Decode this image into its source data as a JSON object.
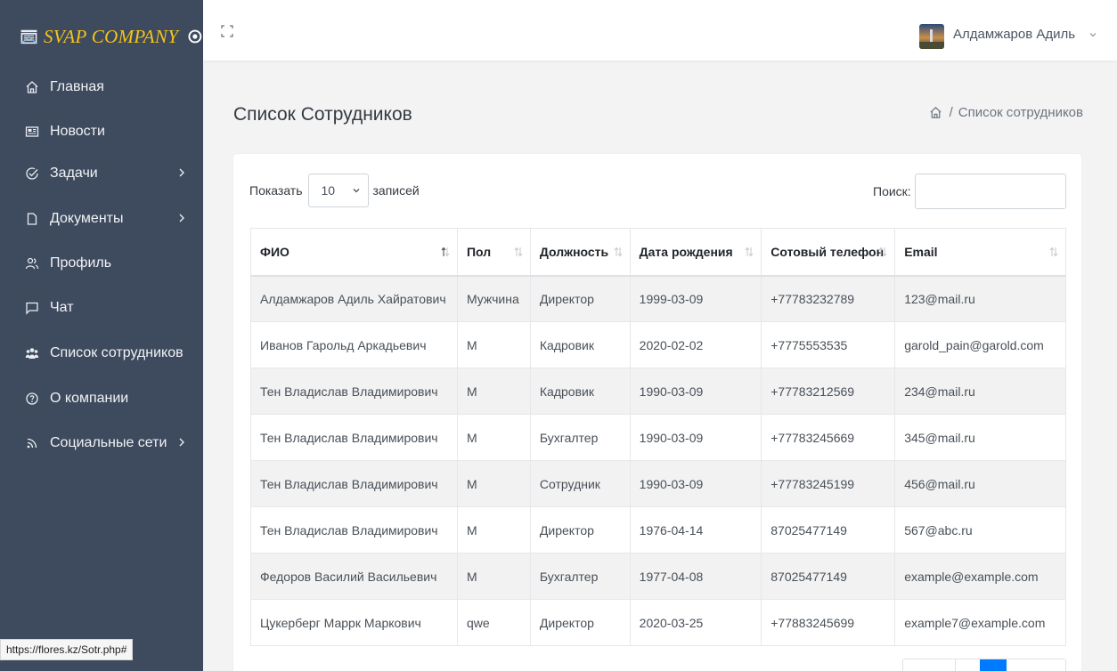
{
  "brand": {
    "name": "SVAP COMPANY"
  },
  "sidebar": {
    "items": [
      {
        "label": "Главная",
        "icon": "home-icon"
      },
      {
        "label": "Новости",
        "icon": "newspaper-icon"
      },
      {
        "label": "Задачи",
        "icon": "check-circle-icon",
        "has_submenu": true
      },
      {
        "label": "Документы",
        "icon": "document-icon",
        "has_submenu": true
      },
      {
        "label": "Профиль",
        "icon": "users-icon"
      },
      {
        "label": "Чат",
        "icon": "chat-icon"
      },
      {
        "label": "Список сотрудников",
        "icon": "team-icon"
      },
      {
        "label": "О компании",
        "icon": "info-circle-icon"
      },
      {
        "label": "Социальные сети",
        "icon": "rss-icon",
        "has_submenu": true
      }
    ]
  },
  "header": {
    "user_name": "Алдамжаров Адиль"
  },
  "page": {
    "title": "Список Сотрудников",
    "breadcrumb": {
      "separator": "/",
      "current": "Список сотрудников"
    }
  },
  "table_controls": {
    "show_label": "Показать",
    "page_size": "10",
    "entries_label": "записей",
    "search_label": "Поиск:",
    "search_value": ""
  },
  "table": {
    "columns": [
      "ФИО",
      "Пол",
      "Должность",
      "Дата рождения",
      "Сотовый телефон",
      "Email"
    ],
    "rows": [
      [
        "Алдамжаров Адиль Хайратович",
        "Мужчина",
        "Директор",
        "1999-03-09",
        "+77783232789",
        "123@mail.ru"
      ],
      [
        "Иванов Гарольд Аркадьевич",
        "М",
        "Кадровик",
        "2020-02-02",
        "+7775553535",
        "garold_pain@garold.com"
      ],
      [
        "Тен Владислав Владимирович",
        "М",
        "Кадровик",
        "1990-03-09",
        "+77783212569",
        "234@mail.ru"
      ],
      [
        "Тен Владислав Владимирович",
        "М",
        "Бухгалтер",
        "1990-03-09",
        "+77783245669",
        "345@mail.ru"
      ],
      [
        "Тен Владислав Владимирович",
        "М",
        "Сотрудник",
        "1990-03-09",
        "+77783245199",
        "456@mail.ru"
      ],
      [
        "Тен Владислав Владимирович",
        "М",
        "Директор",
        "1976-04-14",
        "87025477149",
        "567@abc.ru"
      ],
      [
        "Федоров Василий Васильевич",
        "М",
        "Бухгалтер",
        "1977-04-08",
        "87025477149",
        "example@example.com"
      ],
      [
        "Цукерберг Маррк Маркович",
        "qwe",
        "Директор",
        "2020-03-25",
        "+77883245699",
        "example7@example.com"
      ]
    ]
  },
  "status_bar": {
    "url": "https://flores.kz/Sotr.php#"
  },
  "colors": {
    "sidebar_bg": "#3e4a5e",
    "brand_yellow": "#f5c518",
    "stripe": "#f2f2f2"
  }
}
